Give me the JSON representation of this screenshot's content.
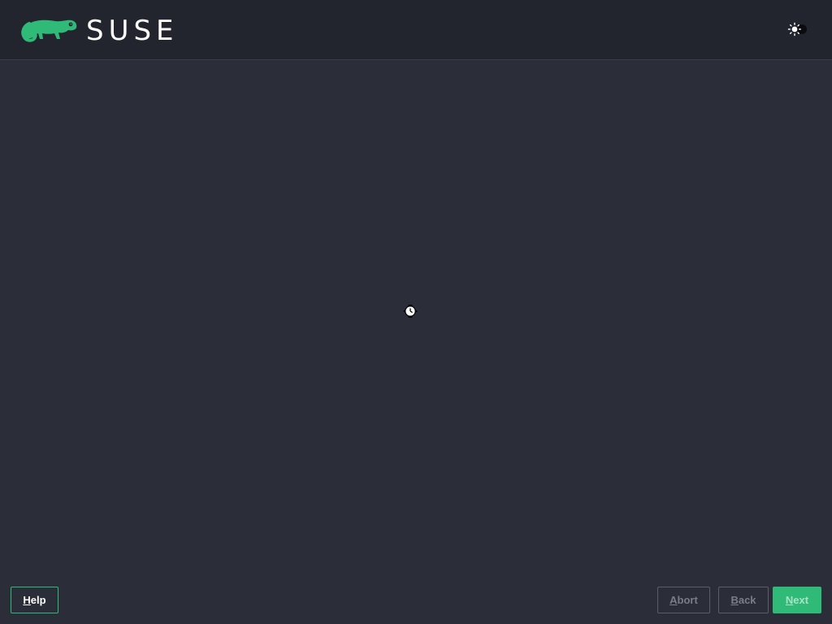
{
  "header": {
    "brand": "SUSE",
    "brand_color": "#30ba78",
    "theme_toggle_icon": "sun-moon-toggle-icon"
  },
  "content": {
    "busy_indicator_icon": "busy-cursor-icon"
  },
  "footer": {
    "help_label": "Help",
    "abort_label": "Abort",
    "back_label": "Back",
    "next_label": "Next"
  },
  "colors": {
    "background": "#2b2d38",
    "header_background": "#23252e",
    "accent": "#30ba78",
    "disabled_text": "#7a7d88"
  }
}
